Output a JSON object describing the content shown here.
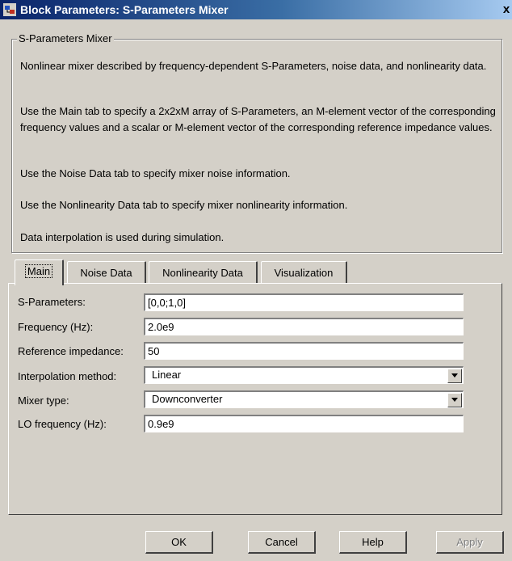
{
  "window": {
    "title": "Block Parameters: S-Parameters Mixer",
    "close_glyph": "x"
  },
  "group": {
    "legend": "S-Parameters Mixer",
    "paragraphs": [
      "Nonlinear mixer described by frequency-dependent S-Parameters, noise data, and nonlinearity data.",
      "Use the Main tab to specify a 2x2xM array of S-Parameters, an M-element vector of the corresponding frequency values and a scalar or M-element vector of the corresponding reference impedance values.",
      "Use the Noise Data tab to specify mixer noise information.",
      "Use the Nonlinearity Data tab to specify mixer nonlinearity information.",
      "Data interpolation is used during simulation."
    ]
  },
  "tabs": [
    {
      "label": "Main",
      "active": true
    },
    {
      "label": "Noise Data",
      "active": false
    },
    {
      "label": "Nonlinearity Data",
      "active": false
    },
    {
      "label": "Visualization",
      "active": false
    }
  ],
  "fields": {
    "s_parameters": {
      "label": "S-Parameters:",
      "value": "[0,0;1,0]"
    },
    "frequency": {
      "label": "Frequency (Hz):",
      "value": "2.0e9"
    },
    "reference_impedance": {
      "label": "Reference impedance:",
      "value": "50"
    },
    "interpolation_method": {
      "label": "Interpolation method:",
      "value": "Linear"
    },
    "mixer_type": {
      "label": "Mixer type:",
      "value": "Downconverter"
    },
    "lo_frequency": {
      "label": "LO frequency (Hz):",
      "value": "0.9e9"
    }
  },
  "buttons": {
    "ok": "OK",
    "cancel": "Cancel",
    "help": "Help",
    "apply": "Apply"
  },
  "colors": {
    "titlebar_start": "#0a246a",
    "titlebar_end": "#a6caf0",
    "face": "#d4d0c8"
  }
}
